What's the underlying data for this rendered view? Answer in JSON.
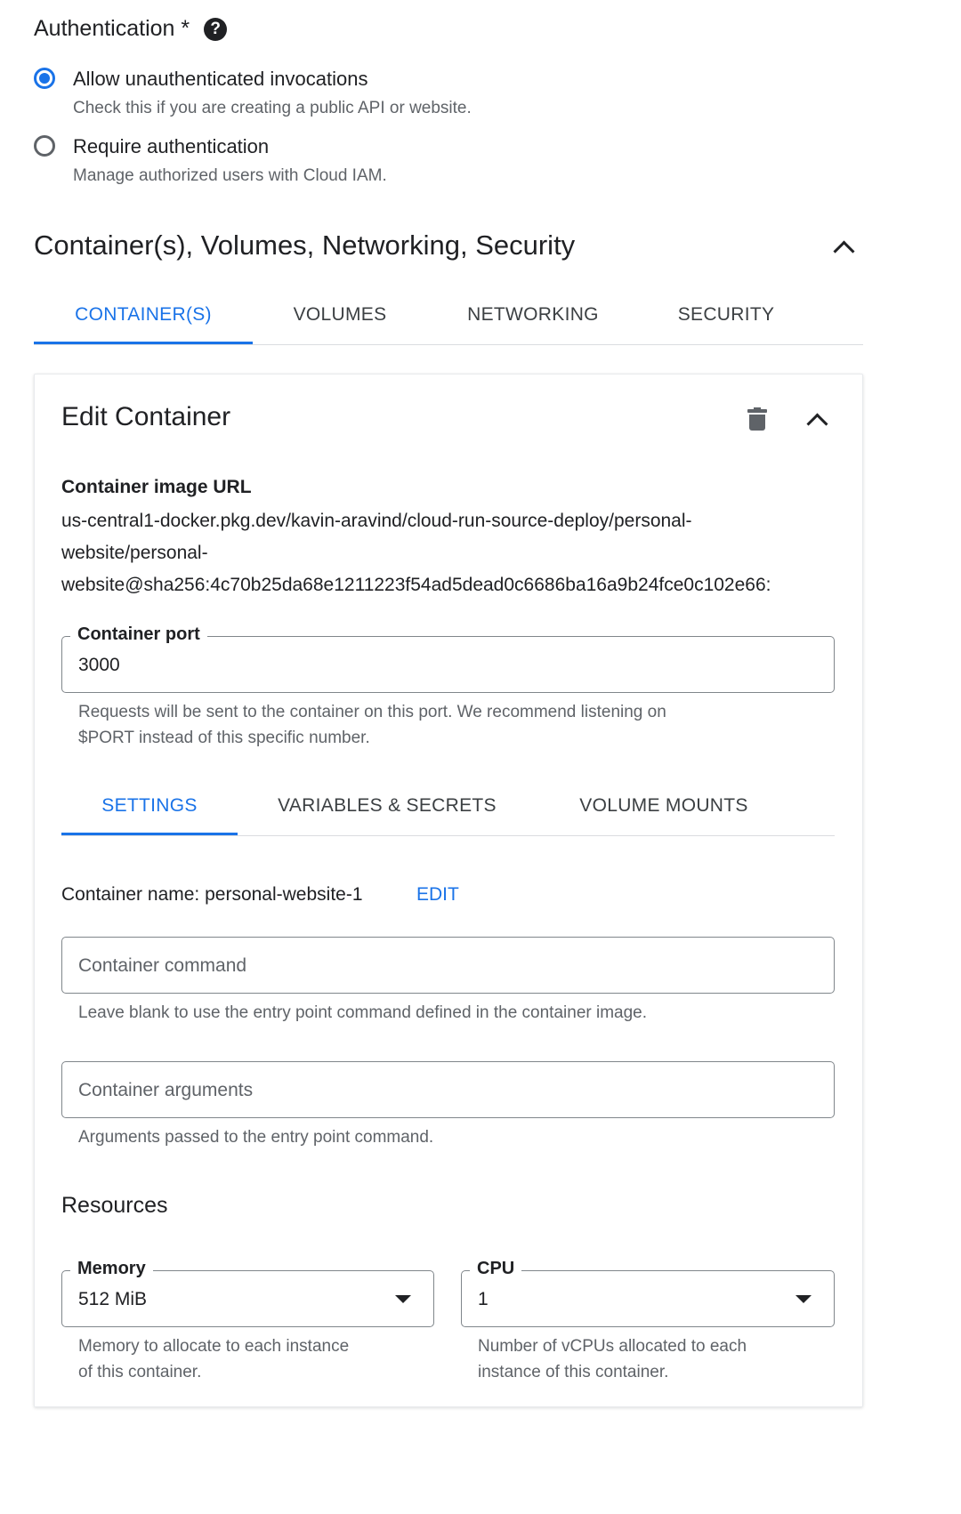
{
  "authentication": {
    "title": "Authentication *",
    "help_icon": "?",
    "options": [
      {
        "label": "Allow unauthenticated invocations",
        "description": "Check this if you are creating a public API or website.",
        "selected": true
      },
      {
        "label": "Require authentication",
        "description": "Manage authorized users with Cloud IAM.",
        "selected": false
      }
    ]
  },
  "section": {
    "title": "Container(s), Volumes, Networking, Security",
    "tabs": [
      {
        "label": "CONTAINER(S)",
        "active": true
      },
      {
        "label": "VOLUMES",
        "active": false
      },
      {
        "label": "NETWORKING",
        "active": false
      },
      {
        "label": "SECURITY",
        "active": false
      }
    ]
  },
  "edit_container": {
    "title": "Edit Container",
    "image_url_label": "Container image URL",
    "image_url_lines": [
      "us-central1-docker.pkg.dev/kavin-aravind/cloud-run-source-deploy/personal-",
      "website/personal-",
      "website@sha256:4c70b25da68e1211223f54ad5dead0c6686ba16a9b24fce0c102e66:"
    ],
    "port": {
      "label": "Container port",
      "value": "3000",
      "hint_lines": [
        "Requests will be sent to the container on this port. We recommend listening on",
        "$PORT instead of this specific number."
      ]
    },
    "sub_tabs": [
      {
        "label": "SETTINGS",
        "active": true
      },
      {
        "label": "VARIABLES & SECRETS",
        "active": false
      },
      {
        "label": "VOLUME MOUNTS",
        "active": false
      }
    ],
    "container_name": "Container name: personal-website-1",
    "edit_link": "EDIT",
    "command": {
      "placeholder": "Container command",
      "hint": "Leave blank to use the entry point command defined in the container image."
    },
    "arguments": {
      "placeholder": "Container arguments",
      "hint": "Arguments passed to the entry point command."
    },
    "resources": {
      "title": "Resources",
      "memory": {
        "label": "Memory",
        "value": "512 MiB",
        "hint_lines": [
          "Memory to allocate to each instance",
          "of this container."
        ]
      },
      "cpu": {
        "label": "CPU",
        "value": "1",
        "hint_lines": [
          "Number of vCPUs allocated to each",
          "instance of this container."
        ]
      }
    }
  },
  "colors": {
    "accent": "#1a73e8",
    "text": "#202124",
    "muted": "#5f6368",
    "border": "#80868b"
  },
  "icons": {
    "help": "help-circle-icon",
    "collapse": "chevron-up-icon",
    "delete": "trash-icon",
    "dropdown": "caret-down-icon"
  }
}
